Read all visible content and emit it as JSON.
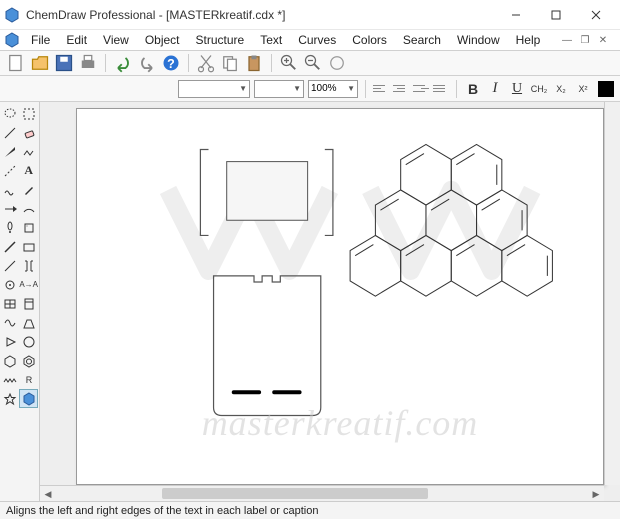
{
  "title": "ChemDraw Professional - [MASTERkreatif.cdx *]",
  "menus": [
    "File",
    "Edit",
    "View",
    "Object",
    "Structure",
    "Text",
    "Curves",
    "Colors",
    "Search",
    "Window",
    "Help"
  ],
  "zoom": "100%",
  "format": {
    "bold": "B",
    "italic": "I",
    "underline": "U",
    "formula": "CH₂",
    "sub": "X₂",
    "sup": "X²"
  },
  "status": "Aligns the left and right edges of the text in each label or caption",
  "watermark": "masterkreatif.com"
}
